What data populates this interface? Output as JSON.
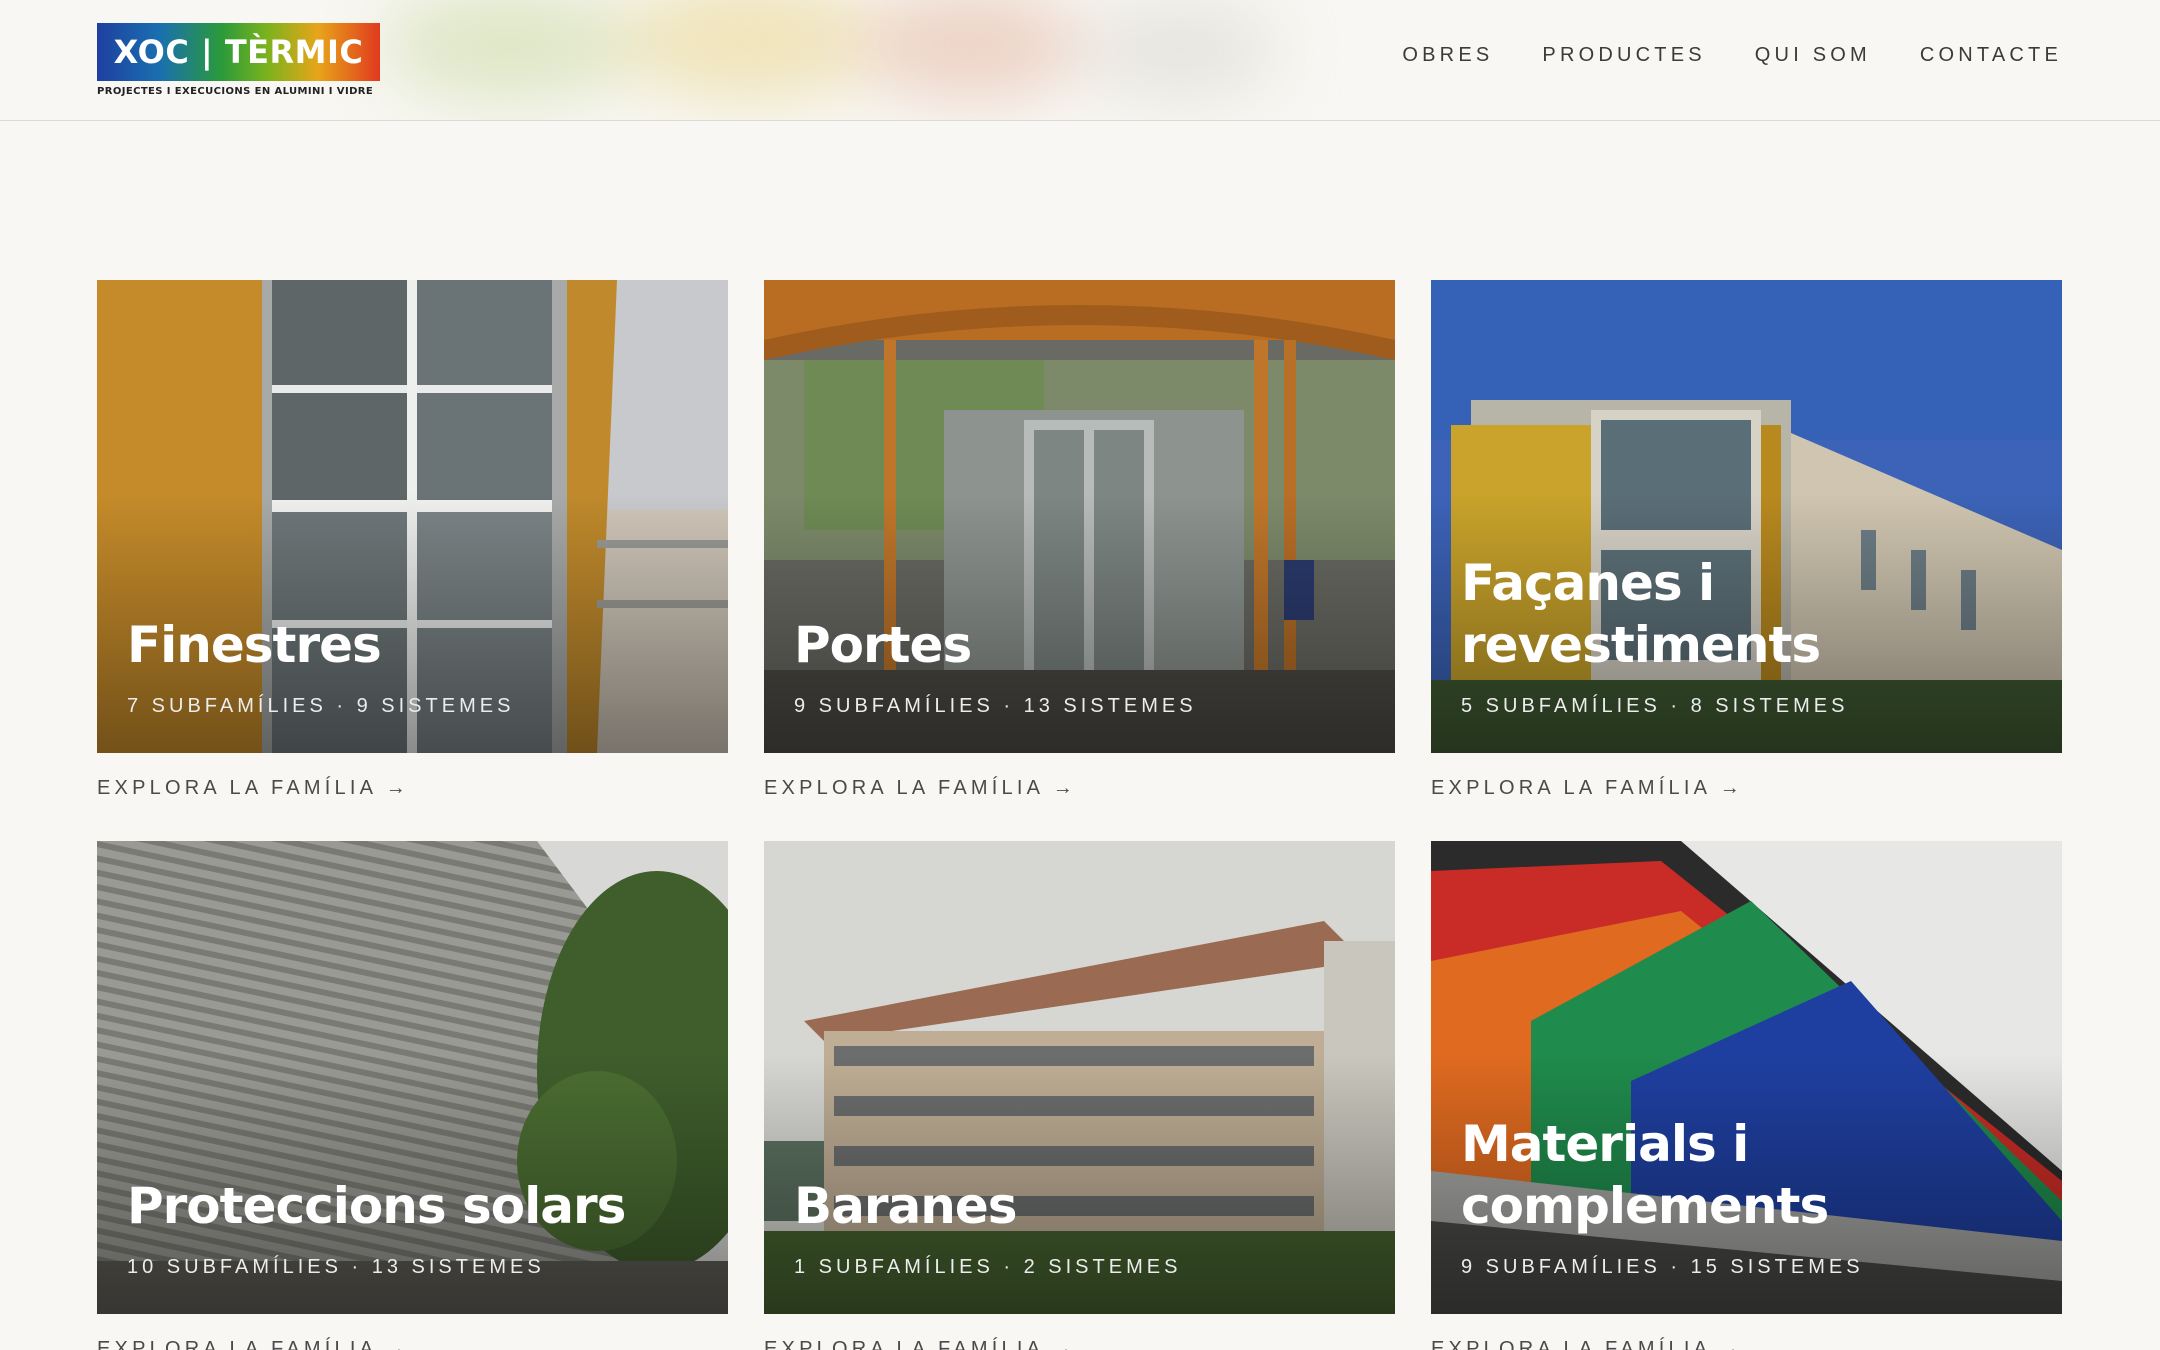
{
  "brand": {
    "logo_text": "XOC | TÈRMIC",
    "tagline": "PROJECTES I EXECUCIONS EN ALUMINI I VIDRE"
  },
  "nav": {
    "items": [
      "OBRES",
      "PRODUCTES",
      "QUI SOM",
      "CONTACTE"
    ]
  },
  "families": [
    {
      "title": "Finestres",
      "meta": "7 SUBFAMÍLIES · 9 SISTEMES",
      "link": "EXPLORA LA FAMÍLIA →"
    },
    {
      "title": "Portes",
      "meta": "9 SUBFAMÍLIES · 13 SISTEMES",
      "link": "EXPLORA LA FAMÍLIA →"
    },
    {
      "title": "Façanes i revestiments",
      "meta": "5 SUBFAMÍLIES · 8 SISTEMES",
      "link": "EXPLORA LA FAMÍLIA →"
    },
    {
      "title": "Proteccions solars",
      "meta": "10 SUBFAMÍLIES · 13 SISTEMES",
      "link": "EXPLORA LA FAMÍLIA →"
    },
    {
      "title": "Baranes",
      "meta": "1 SUBFAMÍLIES · 2 SISTEMES",
      "link": "EXPLORA LA FAMÍLIA →"
    },
    {
      "title": "Materials i complements",
      "meta": "9 SUBFAMÍLIES · 15 SISTEMES",
      "link": "EXPLORA LA FAMÍLIA →"
    }
  ],
  "colors": {
    "background": "#f8f7f3",
    "text": "#3a3a3a",
    "accent_gradient": [
      "#1f3fa0",
      "#2a9a3a",
      "#e7a51a",
      "#e03a1e"
    ]
  }
}
